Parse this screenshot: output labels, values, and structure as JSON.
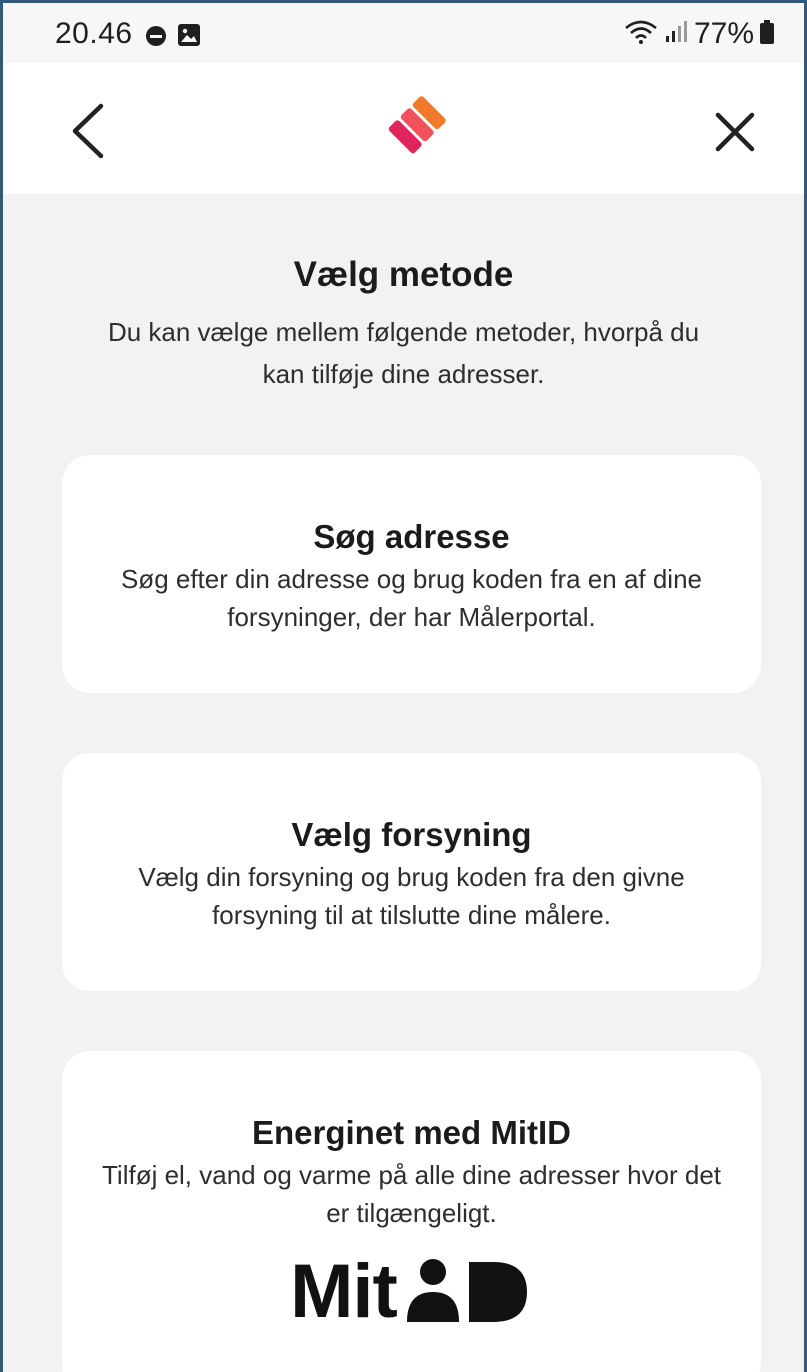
{
  "status_bar": {
    "time": "20.46",
    "battery": "77%",
    "icons": [
      "do-not-disturb-icon",
      "image-icon",
      "wifi-icon",
      "signal-icon",
      "battery-icon"
    ]
  },
  "header": {
    "back_icon": "chevron-left-icon",
    "close_icon": "close-icon",
    "logo": "app-logo"
  },
  "main": {
    "title": "Vælg metode",
    "subtitle": "Du kan vælge mellem følgende metoder, hvorpå du kan tilføje dine adresser."
  },
  "cards": [
    {
      "title": "Søg adresse",
      "description": "Søg efter din adresse og brug koden fra en af dine forsyninger, der har Målerportal."
    },
    {
      "title": "Vælg forsyning",
      "description": "Vælg din forsyning og brug koden fra den givne forsyning til at tilslutte dine målere."
    },
    {
      "title": "Energinet med MitID",
      "description": "Tilføj el, vand og varme på alle dine adresser hvor det er tilgængeligt.",
      "logo_text": "MitID"
    }
  ],
  "colors": {
    "background": "#f2f2f2",
    "card": "#ffffff",
    "logo_orange": "#f07a2a",
    "logo_pink": "#e0245e"
  }
}
